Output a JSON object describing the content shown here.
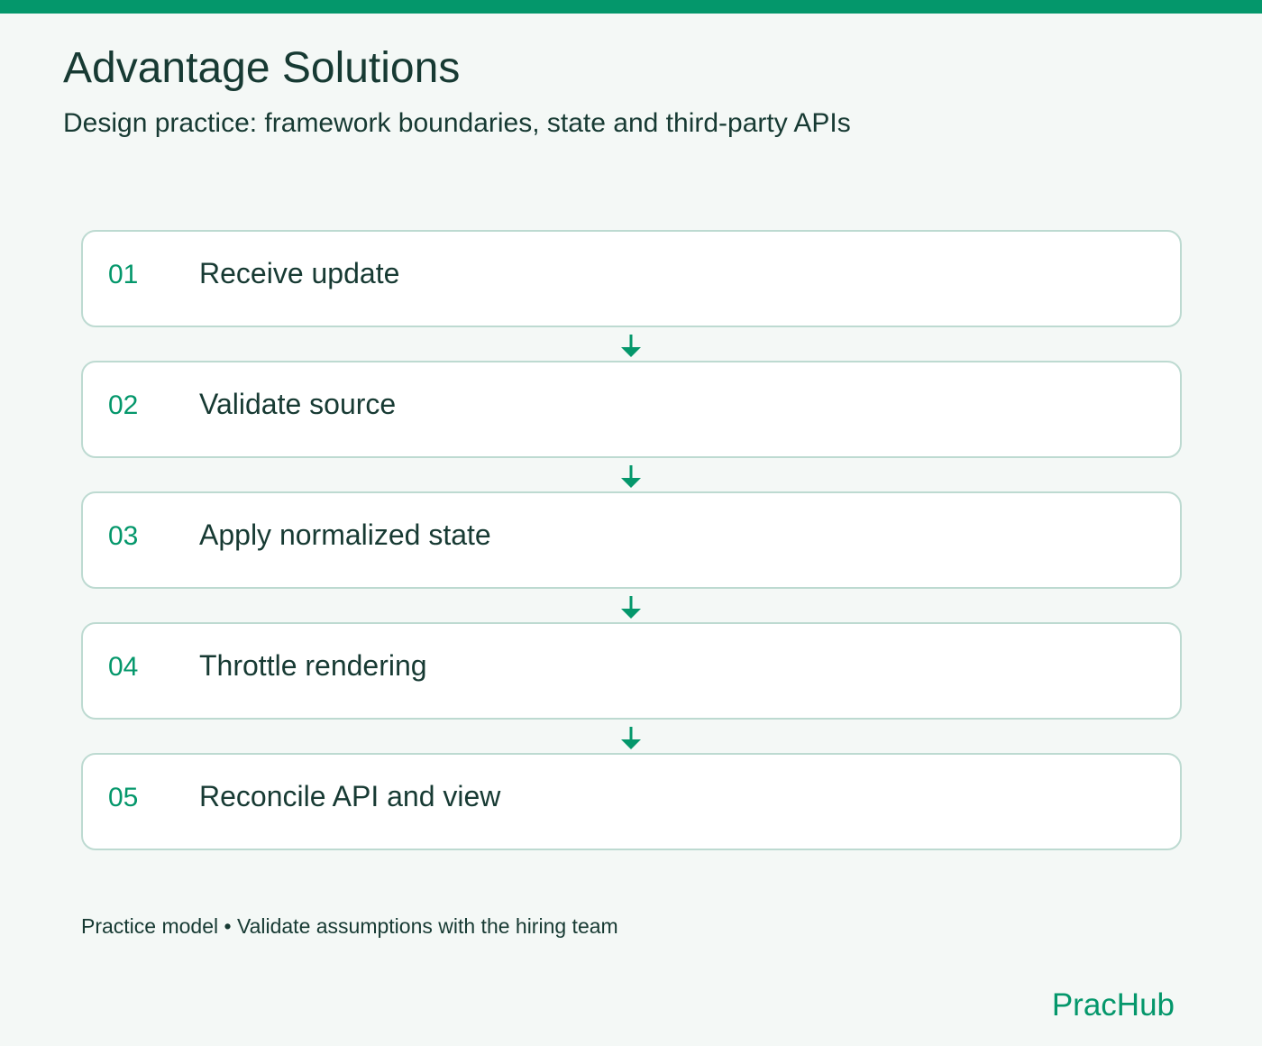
{
  "header": {
    "title": "Advantage Solutions",
    "subtitle": "Design practice: framework boundaries, state and third-party APIs"
  },
  "steps": [
    {
      "number": "01",
      "label": "Receive update"
    },
    {
      "number": "02",
      "label": "Validate source"
    },
    {
      "number": "03",
      "label": "Apply normalized state"
    },
    {
      "number": "04",
      "label": "Throttle rendering"
    },
    {
      "number": "05",
      "label": "Reconcile API and view"
    }
  ],
  "footer": {
    "note": "Practice model • Validate assumptions with the hiring team",
    "brand": "PracHub"
  },
  "colors": {
    "accent": "#04976b",
    "text": "#173a33",
    "background": "#f4f8f6",
    "card_border": "#bddad1",
    "card_background": "#ffffff"
  },
  "icons": {
    "connector": "arrow-down-icon"
  }
}
